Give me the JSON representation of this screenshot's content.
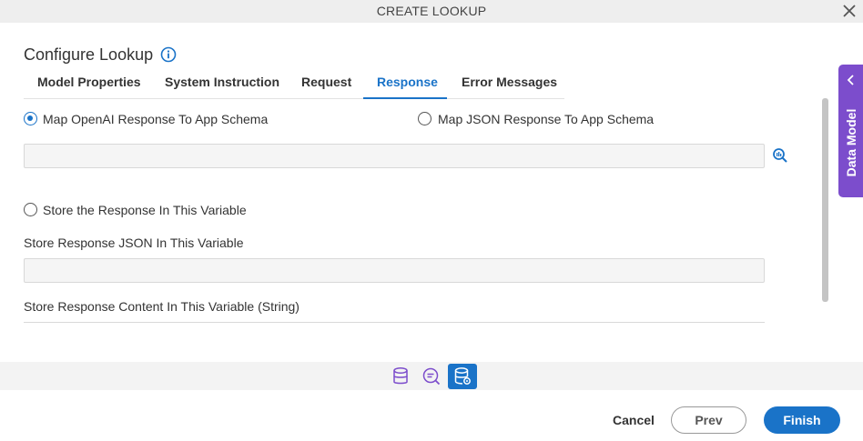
{
  "window": {
    "title": "CREATE LOOKUP"
  },
  "page": {
    "heading": "Configure Lookup"
  },
  "tabs": [
    {
      "label": "Model Properties",
      "active": false
    },
    {
      "label": "System Instruction",
      "active": false
    },
    {
      "label": "Request",
      "active": false
    },
    {
      "label": "Response",
      "active": true
    },
    {
      "label": "Error Messages",
      "active": false
    }
  ],
  "response": {
    "map_openai_label": "Map OpenAI Response To App Schema",
    "map_openai_selected": true,
    "map_json_label": "Map JSON Response To App Schema",
    "map_json_selected": false,
    "schema_value": "",
    "store_response_label": "Store the Response In This Variable",
    "store_response_selected": false,
    "store_json_label": "Store Response JSON In This Variable",
    "store_json_value": "",
    "store_content_label": "Store Response Content In This Variable (String)",
    "store_content_value": ""
  },
  "side_panel": {
    "label": "Data Model"
  },
  "footer": {
    "cancel": "Cancel",
    "prev": "Prev",
    "finish": "Finish"
  },
  "colors": {
    "accent": "#1a73c8",
    "data_model": "#7c4dcc"
  },
  "icons": [
    "close-icon",
    "info-icon",
    "search-icon",
    "chevron-left-icon",
    "database-icon",
    "chat-icon",
    "database-settings-icon"
  ]
}
